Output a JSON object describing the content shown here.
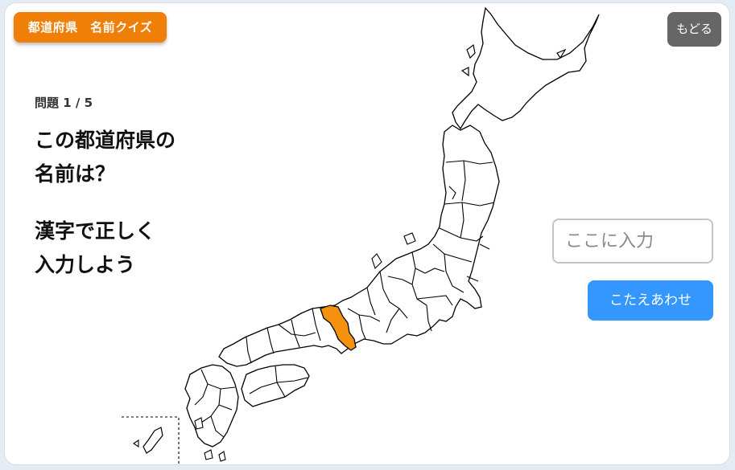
{
  "app": {
    "badge": "都道府県　名前クイズ",
    "back_label": "もどる"
  },
  "quiz": {
    "counter": "問題 1 / 5",
    "question": "この都道府県の\n名前は？",
    "instruction": "漢字で正しく\n入力しよう"
  },
  "answer": {
    "placeholder": "ここに入力",
    "value": "",
    "submit_label": "こたえあわせ"
  },
  "map": {
    "highlight_color": "#f4920d",
    "outline_color": "#000000",
    "fill_color": "#ffffff"
  }
}
